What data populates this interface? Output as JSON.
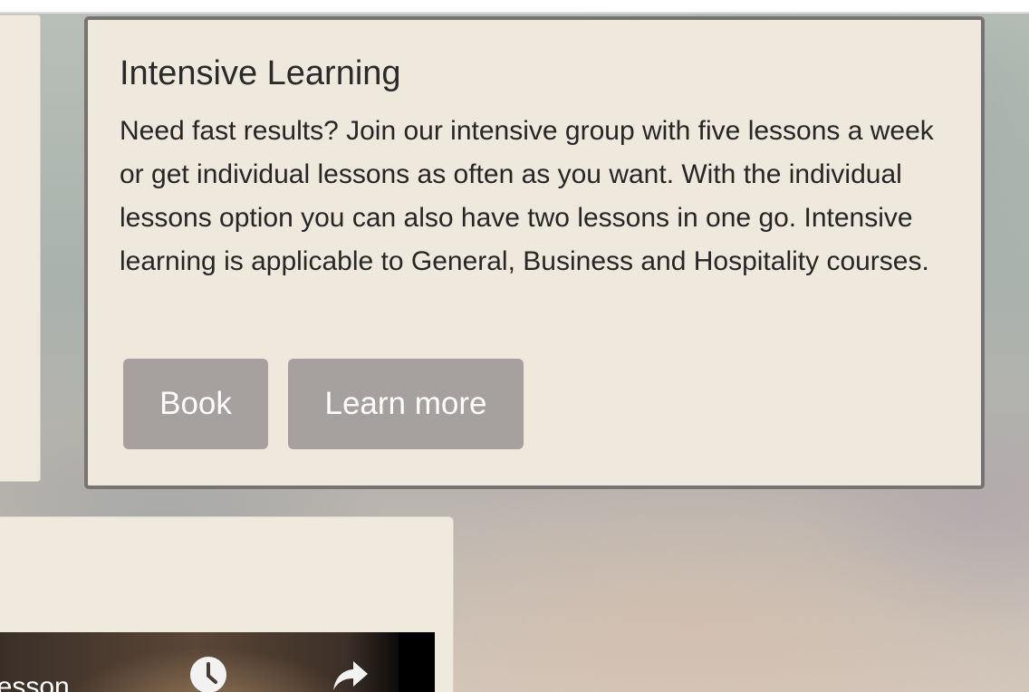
{
  "feature": {
    "title": "Intensive Learning",
    "description": "Need fast results? Join our intensive group with five lessons a week or get individual lessons as often as you want. With the individual lessons option you can also have two lessons in one go. Intensive learning is applicable to General, Business and Hospitality courses.",
    "buttons": {
      "book": "Book",
      "learn_more": "Learn more"
    }
  },
  "video": {
    "title": "lesson",
    "icons": [
      "clock-icon",
      "share-icon"
    ]
  },
  "colors": {
    "card_background": "#eee8dd",
    "card_border": "#777373",
    "button_background": "#a6a09e",
    "button_text": "#ffffff"
  }
}
